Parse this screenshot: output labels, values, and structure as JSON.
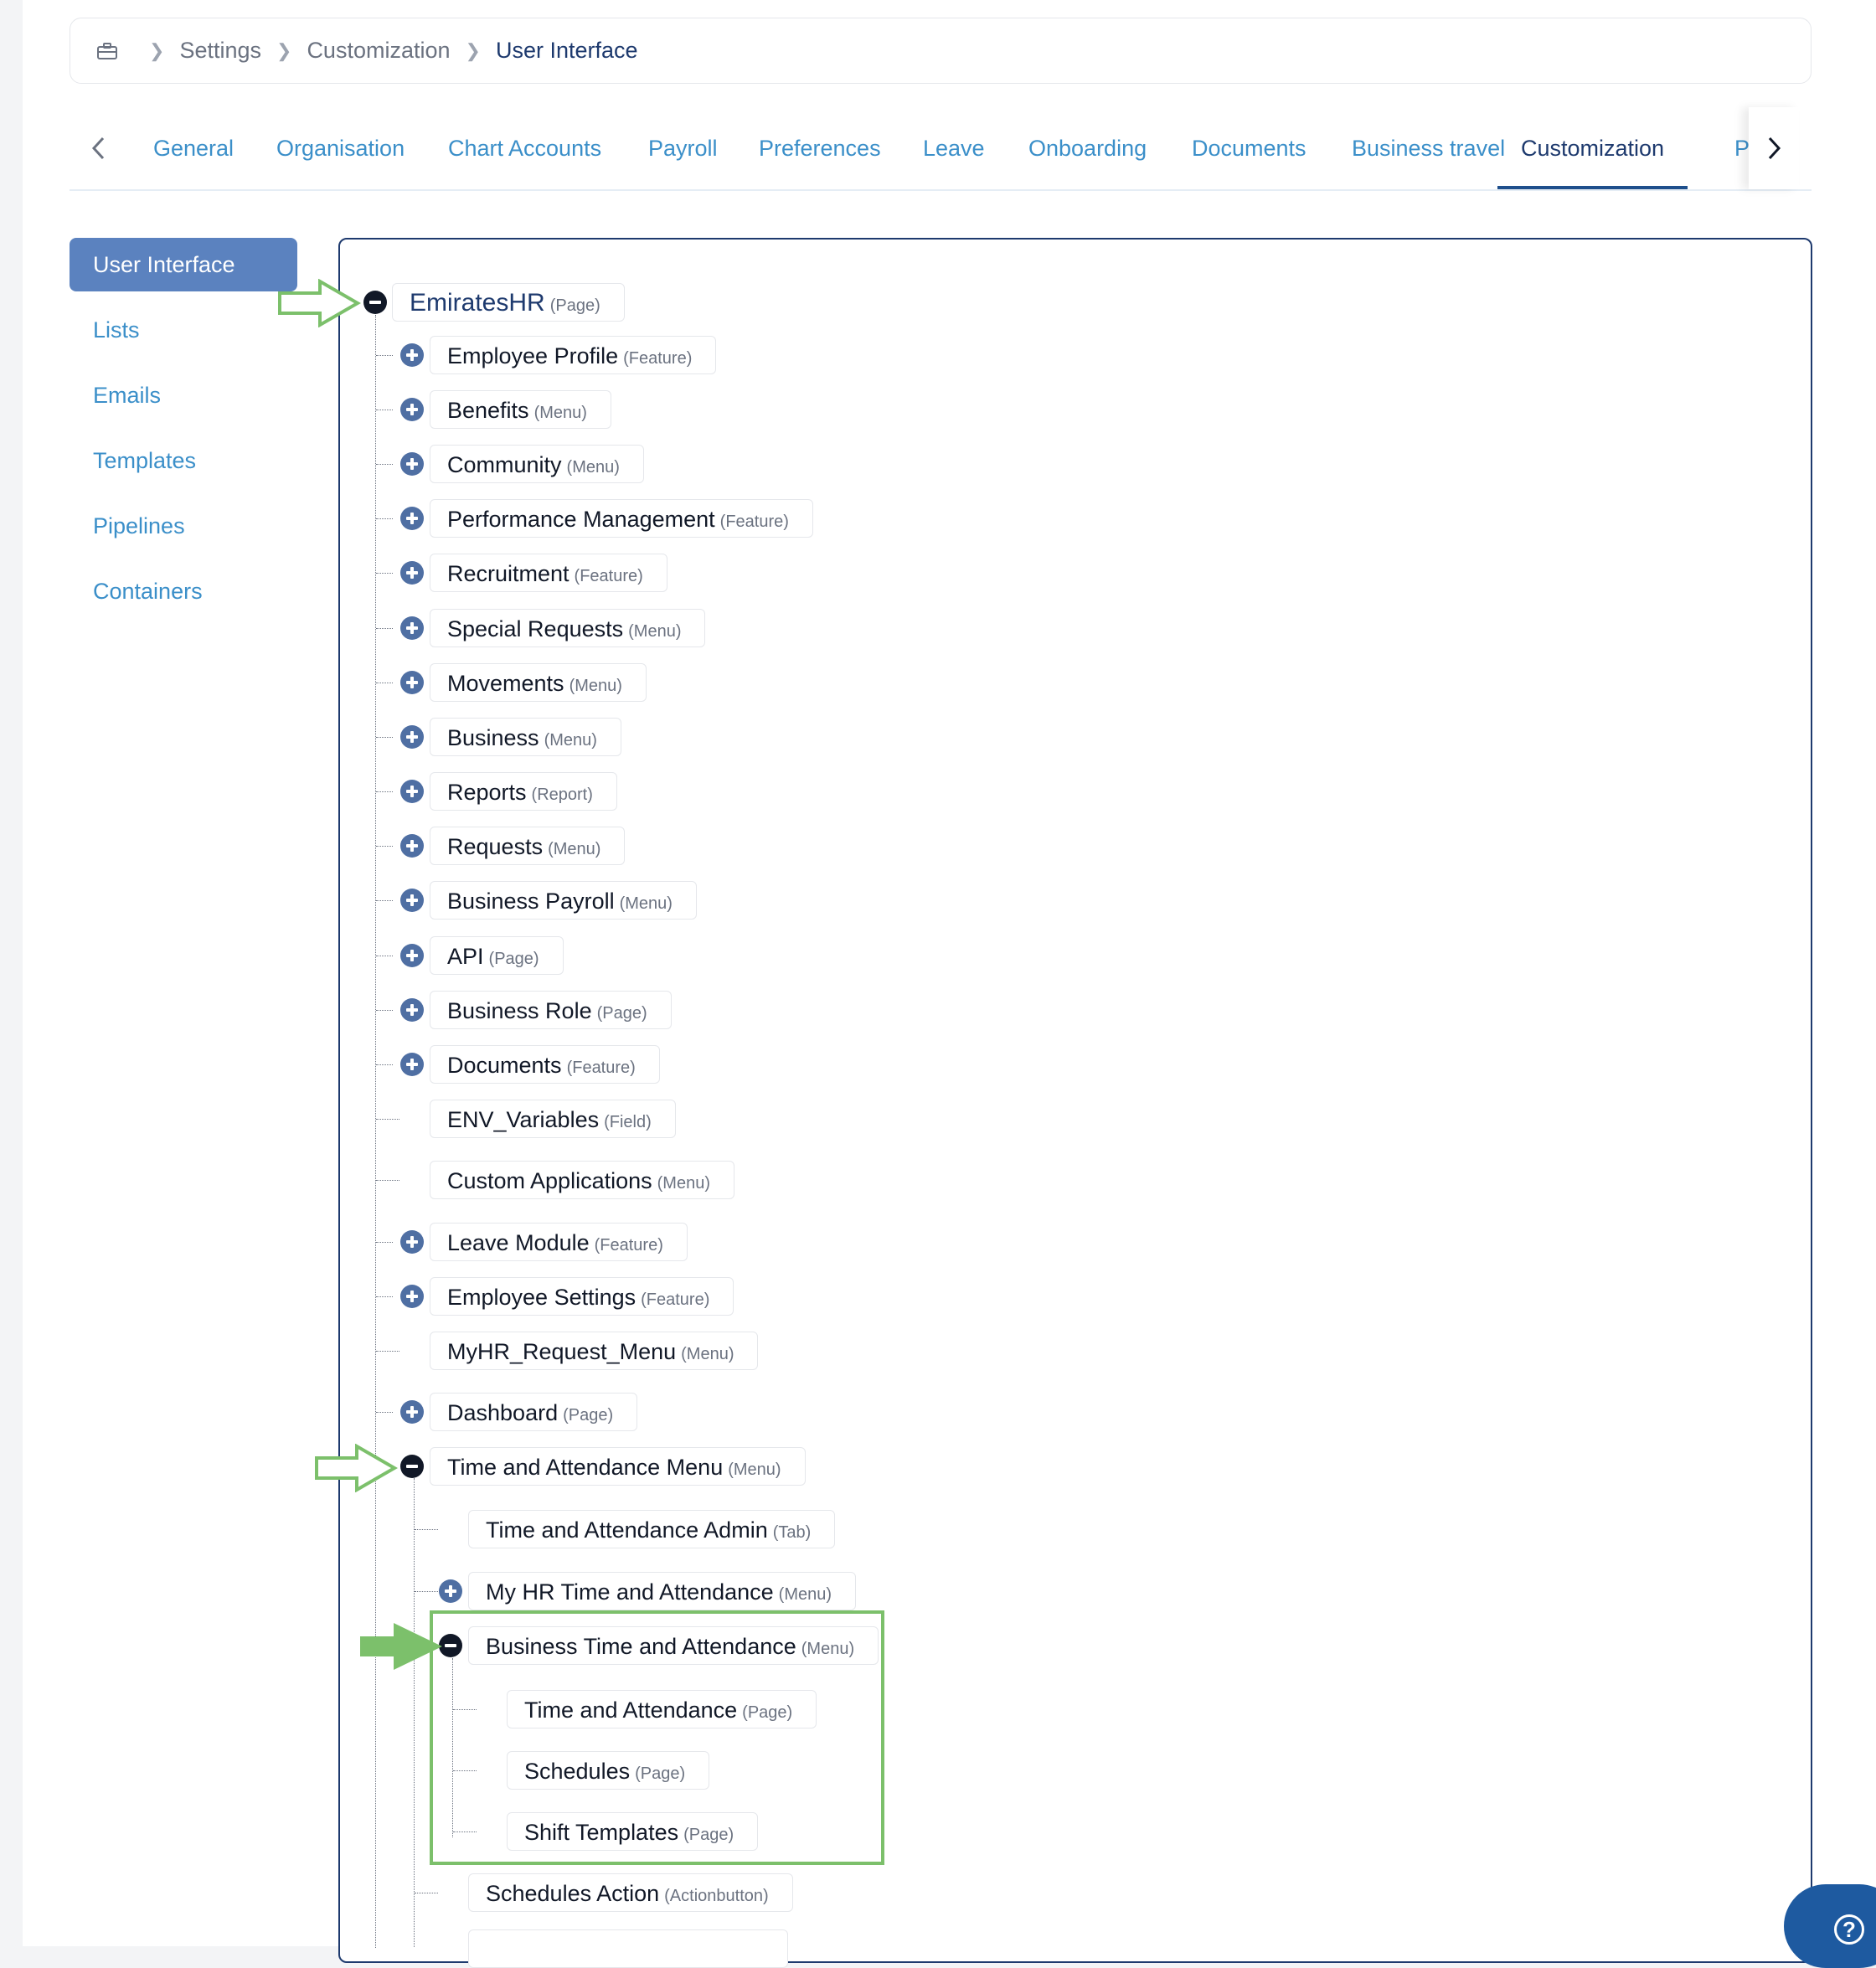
{
  "breadcrumb": {
    "icon": "briefcase-icon",
    "items": [
      "Settings",
      "Customization"
    ],
    "current": "User Interface"
  },
  "tabs": {
    "items": [
      "General",
      "Organisation",
      "Chart Accounts",
      "Payroll",
      "Preferences",
      "Leave",
      "Onboarding",
      "Documents",
      "Business travel",
      "Customization",
      "Po"
    ],
    "active": "Customization"
  },
  "sidenav": {
    "items": [
      "User Interface",
      "Lists",
      "Emails",
      "Templates",
      "Pipelines",
      "Containers"
    ],
    "active": "User Interface"
  },
  "tree": {
    "root": {
      "label": "EmiratesHR",
      "type": "(Page)",
      "state": "expanded"
    },
    "level1": [
      {
        "label": "Employee Profile",
        "type": "(Feature)",
        "toggle": "plus"
      },
      {
        "label": "Benefits",
        "type": "(Menu)",
        "toggle": "plus"
      },
      {
        "label": "Community",
        "type": "(Menu)",
        "toggle": "plus"
      },
      {
        "label": "Performance Management",
        "type": "(Feature)",
        "toggle": "plus"
      },
      {
        "label": "Recruitment",
        "type": "(Feature)",
        "toggle": "plus"
      },
      {
        "label": "Special Requests",
        "type": "(Menu)",
        "toggle": "plus"
      },
      {
        "label": "Movements",
        "type": "(Menu)",
        "toggle": "plus"
      },
      {
        "label": "Business",
        "type": "(Menu)",
        "toggle": "plus"
      },
      {
        "label": "Reports",
        "type": "(Report)",
        "toggle": "plus"
      },
      {
        "label": "Requests",
        "type": "(Menu)",
        "toggle": "plus"
      },
      {
        "label": "Business Payroll",
        "type": "(Menu)",
        "toggle": "plus"
      },
      {
        "label": "API",
        "type": "(Page)",
        "toggle": "plus"
      },
      {
        "label": "Business Role",
        "type": "(Page)",
        "toggle": "plus"
      },
      {
        "label": "Documents",
        "type": "(Feature)",
        "toggle": "plus"
      },
      {
        "label": "ENV_Variables",
        "type": "(Field)",
        "toggle": "none"
      },
      {
        "label": "Custom Applications",
        "type": "(Menu)",
        "toggle": "none"
      },
      {
        "label": "Leave Module",
        "type": "(Feature)",
        "toggle": "plus"
      },
      {
        "label": "Employee Settings",
        "type": "(Feature)",
        "toggle": "plus"
      },
      {
        "label": "MyHR_Request_Menu",
        "type": "(Menu)",
        "toggle": "none"
      },
      {
        "label": "Dashboard",
        "type": "(Page)",
        "toggle": "plus"
      },
      {
        "label": "Time and Attendance Menu",
        "type": "(Menu)",
        "toggle": "minus"
      }
    ],
    "level2": [
      {
        "label": "Time and Attendance Admin",
        "type": "(Tab)",
        "toggle": "none"
      },
      {
        "label": "My HR Time and Attendance",
        "type": "(Menu)",
        "toggle": "plus"
      },
      {
        "label": "Business Time and Attendance",
        "type": "(Menu)",
        "toggle": "minus"
      },
      {
        "label": "Schedules Action",
        "type": "(Actionbutton)",
        "toggle": "none"
      }
    ],
    "level3": [
      {
        "label": "Time and Attendance",
        "type": "(Page)"
      },
      {
        "label": "Schedules",
        "type": "(Page)"
      },
      {
        "label": "Shift Templates",
        "type": "(Page)"
      }
    ]
  },
  "annotations": {
    "arrow_color": "#7cc06b",
    "highlight_color": "#7cc06b"
  },
  "help_icon": "question-circle-icon"
}
